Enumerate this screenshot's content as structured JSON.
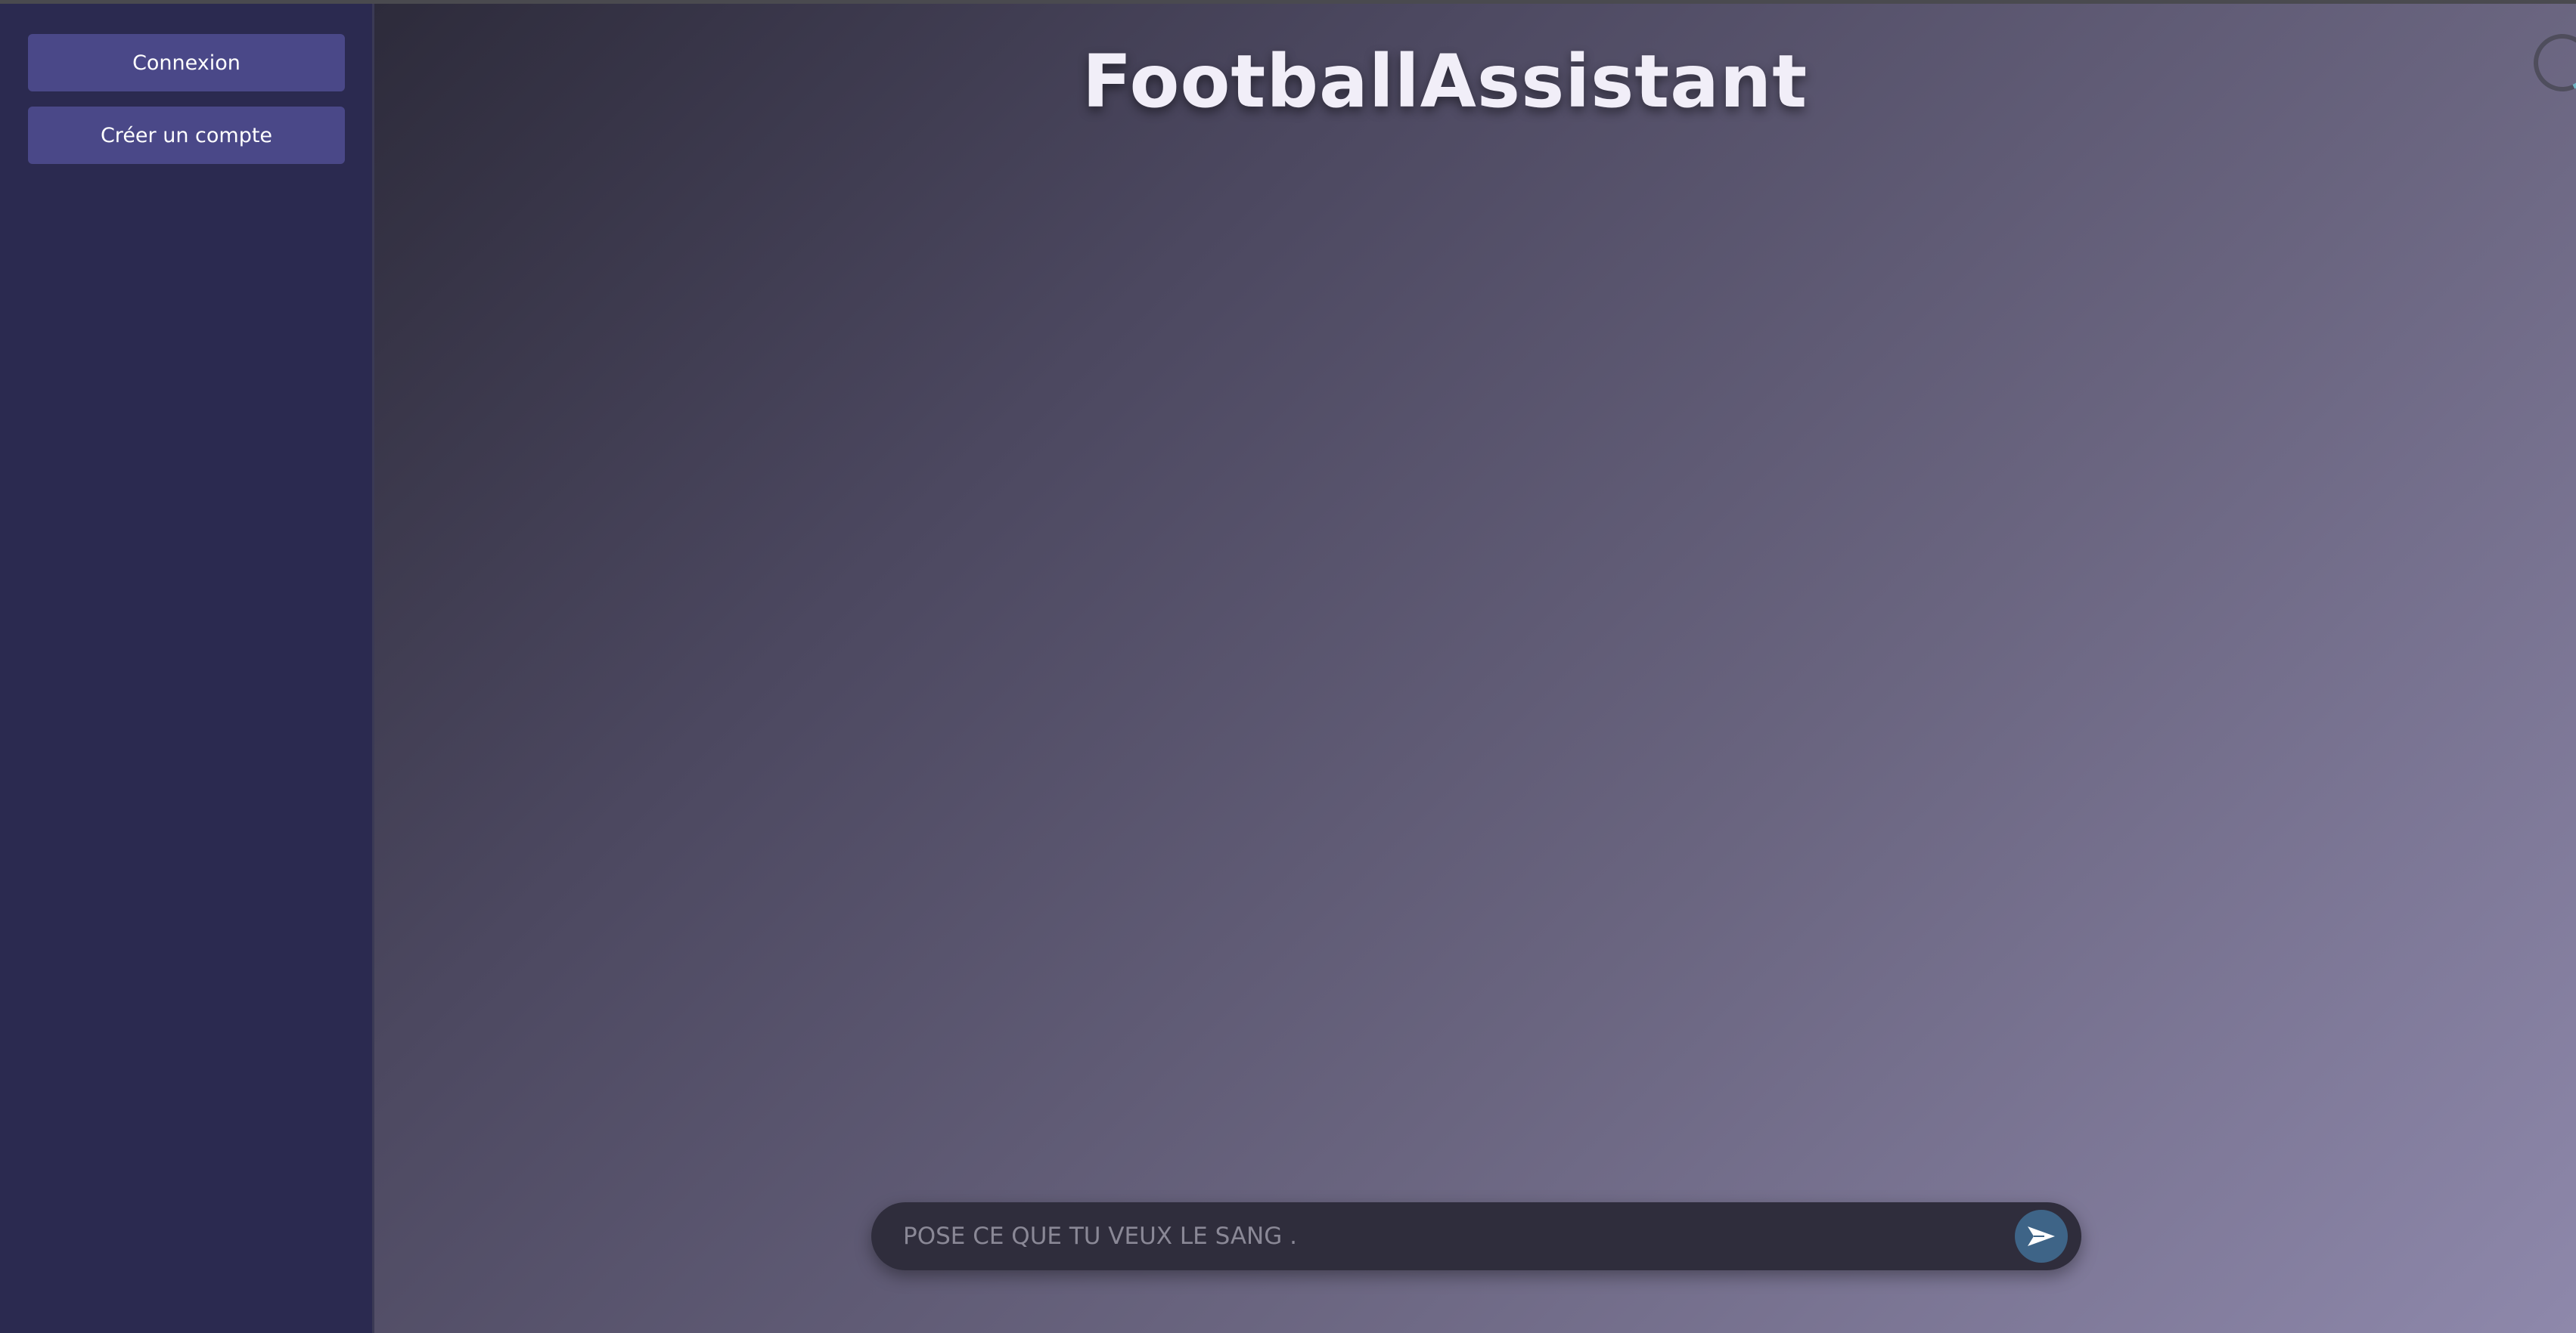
{
  "sidebar": {
    "login_label": "Connexion",
    "signup_label": "Créer un compte"
  },
  "main": {
    "title": "FootballAssistant"
  },
  "chat": {
    "placeholder": "POSE CE QUE TU VEUX LE SANG .",
    "value": "",
    "send_icon": "send-icon"
  },
  "status": {
    "loading_icon": "loading-spinner-icon"
  },
  "colors": {
    "sidebar_bg": "#2b2a50",
    "button_bg": "#4a4888",
    "send_button_bg": "#3e6487",
    "title_color": "#f1eef8"
  }
}
